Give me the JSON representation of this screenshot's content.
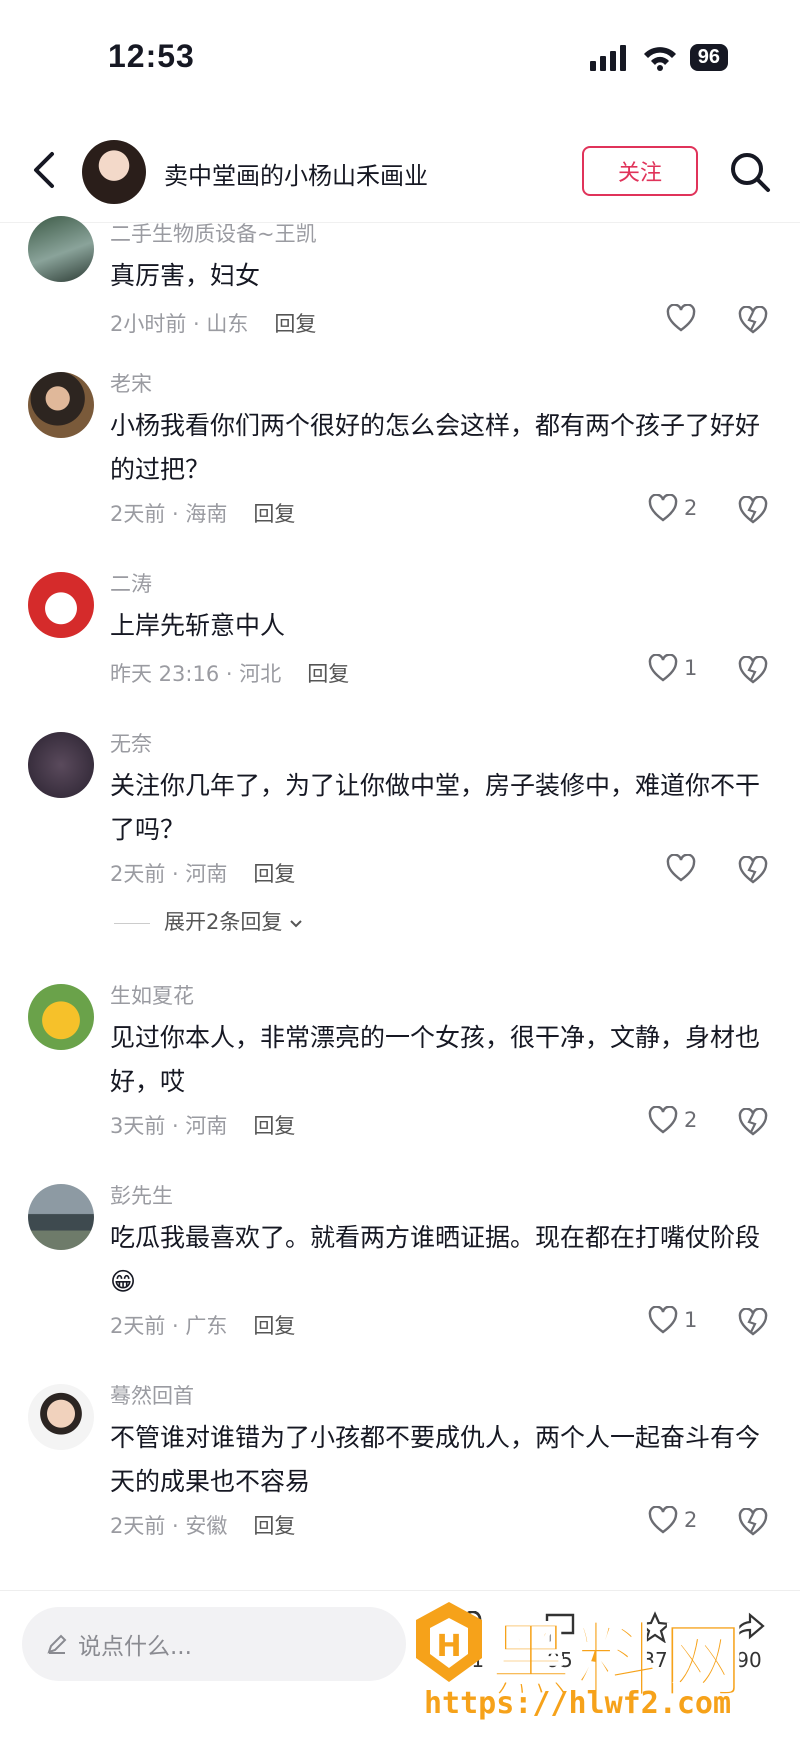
{
  "status_bar": {
    "time": "12:53",
    "battery": "96"
  },
  "header": {
    "title": "卖中堂画的小杨山禾画业",
    "follow_label": "关注"
  },
  "comments": [
    {
      "name": "二手生物质设备~王凯",
      "text": "真厉害，妇女",
      "time_loc": "2小时前 · 山东",
      "reply": "回复",
      "likes": ""
    },
    {
      "name": "老宋",
      "text": "小杨我看你们两个很好的怎么会这样，都有两个孩子了好好的过把？",
      "time_loc": "2天前 · 海南",
      "reply": "回复",
      "likes": "2"
    },
    {
      "name": "二涛",
      "text": "上岸先斩意中人",
      "time_loc": "昨天 23:16 · 河北",
      "reply": "回复",
      "likes": "1"
    },
    {
      "name": "无奈",
      "text": "关注你几年了，为了让你做中堂，房子装修中，难道你不干了吗？",
      "time_loc": "2天前 · 河南",
      "reply": "回复",
      "likes": "",
      "expand": "展开2条回复"
    },
    {
      "name": "生如夏花",
      "text": "见过你本人，非常漂亮的一个女孩，很干净，文静，身材也好，哎",
      "time_loc": "3天前 · 河南",
      "reply": "回复",
      "likes": "2"
    },
    {
      "name": "彭先生",
      "text": "吃瓜我最喜欢了。就看两方谁晒证据。现在都在打嘴仗阶段😁",
      "time_loc": "2天前 · 广东",
      "reply": "回复",
      "likes": "1"
    },
    {
      "name": "蓦然回首",
      "text": "不管谁对谁错为了小孩都不要成仇人，两个人一起奋斗有今天的成果也不容易",
      "time_loc": "2天前 · 安徽",
      "reply": "回复",
      "likes": "2"
    }
  ],
  "bottom_bar": {
    "input_placeholder": "说点什么...",
    "counts": [
      "231",
      "95",
      "37",
      "90"
    ]
  },
  "watermark": {
    "text": "黑料网",
    "url": "https://hlwf2.com"
  }
}
